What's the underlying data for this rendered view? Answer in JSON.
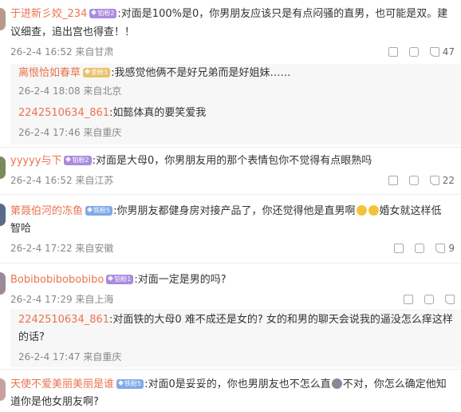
{
  "comments": [
    {
      "user": "于进新彡姣_234",
      "badge": "铂粉2",
      "text1": ":对面是100%是0，你男朋友应该只是有点闷骚的直男，也可能是双。建",
      "text2": "议细查，追出宫也得查！！",
      "meta": "26-2-4 16:52 来自甘肃",
      "likes": "47",
      "replies": [
        {
          "user": "离恨恰如春草",
          "badge": "金粉3",
          "text": ":我感觉他俩不是好兄弟而是好姐妹……",
          "meta": "26-2-4 18:08 来自北京"
        },
        {
          "user": "2242510634_861",
          "badge": "",
          "text": ":如懿体真的要笑爱我",
          "meta": "26-2-4 17:46 来自重庆"
        }
      ]
    },
    {
      "user": "yyyyy与下",
      "badge": "铂粉2",
      "text1": ":对面是大母0，你男朋友用的那个表情包你不觉得有点眼熟吗",
      "meta": "26-2-4 16:52 来自江苏",
      "likes": "22"
    },
    {
      "user": "第聂伯河的冻鱼",
      "badge": "铁粉5",
      "text1": ":你男朋友都健身房对接产品了，你还觉得他是直男啊",
      "text1b": "婚女就这样低",
      "text2": "智哈",
      "meta": "26-2-4 17:22 来自安徽",
      "likes": "9"
    },
    {
      "user": "Bobibobibobobibo",
      "badge": "铂粉1",
      "text1": ":对面一定是男的吗?",
      "meta": "26-2-4 17:29 来自上海",
      "likes": "",
      "replies": [
        {
          "user": "2242510634_861",
          "badge": "",
          "text": ":对面铁的大母0 难不成还是女的? 女的和男的聊天会说我的逼没怎么痒这样",
          "text2": "的话?",
          "meta": "26-2-4 17:47 来自重庆"
        }
      ]
    },
    {
      "user": "天使不爱美丽美丽是谁",
      "badge": "铁粉5",
      "text1": ":对面0是妥妥的，你也男朋友也不怎么直",
      "text1b": "不对，你怎么确定他知",
      "text2": "道你是他女朋友啊?"
    }
  ],
  "colors": {
    "username": "#eb7350",
    "meta": "#888888",
    "accent_purple": "#a98be0",
    "accent_blue": "#7fa9e8",
    "accent_gold": "#e9c26a"
  }
}
